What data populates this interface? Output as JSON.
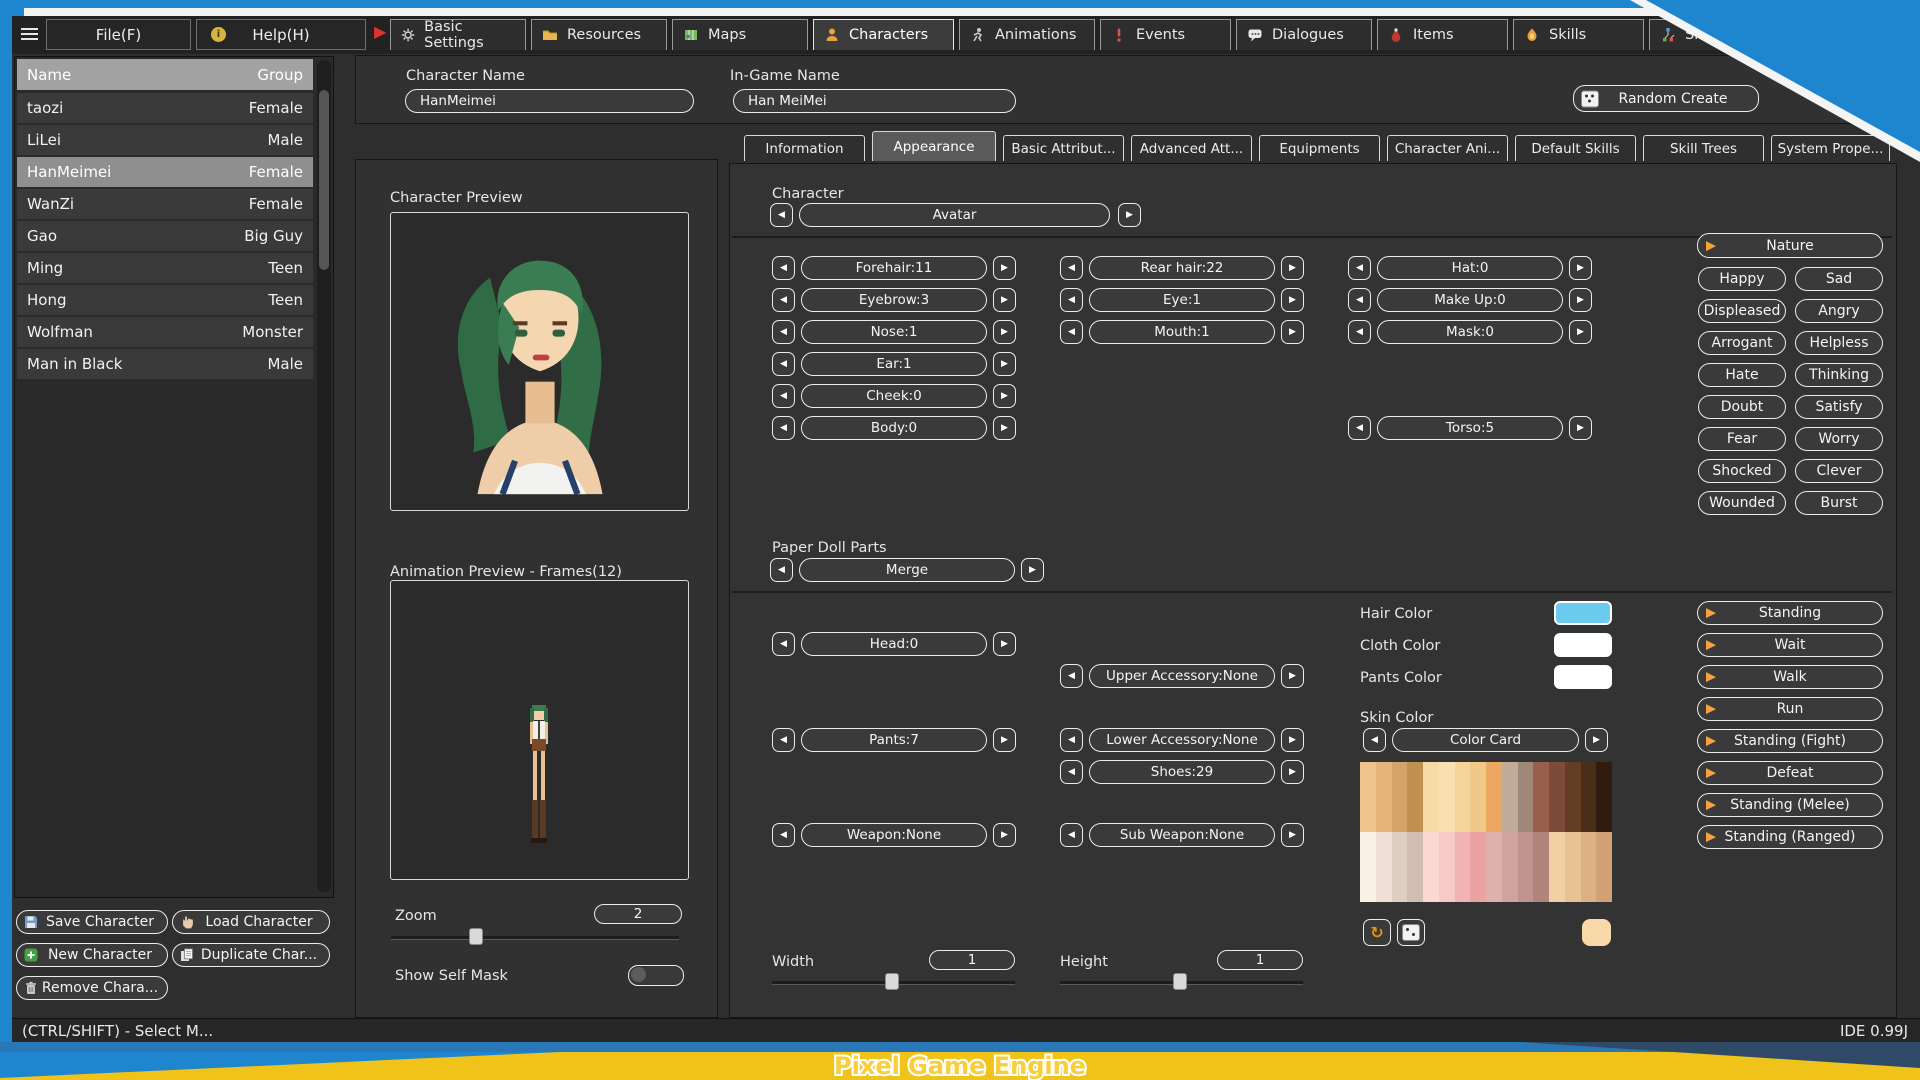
{
  "menu": {
    "file": "File(F)",
    "help": "Help(H)"
  },
  "main_tabs": [
    {
      "label": "Basic Settings"
    },
    {
      "label": "Resources"
    },
    {
      "label": "Maps"
    },
    {
      "label": "Characters",
      "active": true
    },
    {
      "label": "Animations"
    },
    {
      "label": "Events"
    },
    {
      "label": "Dialogues"
    },
    {
      "label": "Items"
    },
    {
      "label": "Skills"
    },
    {
      "label": "Skill Trees"
    }
  ],
  "character_list": {
    "header": {
      "name": "Name",
      "group": "Group"
    },
    "rows": [
      {
        "name": "taozi",
        "group": "Female"
      },
      {
        "name": "LiLei",
        "group": "Male"
      },
      {
        "name": "HanMeimei",
        "group": "Female",
        "selected": true
      },
      {
        "name": "WanZi",
        "group": "Female"
      },
      {
        "name": "Gao",
        "group": "Big Guy"
      },
      {
        "name": "Ming",
        "group": "Teen"
      },
      {
        "name": "Hong",
        "group": "Teen"
      },
      {
        "name": "Wolfman",
        "group": "Monster"
      },
      {
        "name": "Man in Black",
        "group": "Male"
      }
    ],
    "buttons": {
      "save": "Save Character",
      "load": "Load Character",
      "new": "New Character",
      "duplicate": "Duplicate Char...",
      "remove": "Remove Chara..."
    }
  },
  "name_bar": {
    "char_name_label": "Character Name",
    "char_name": "HanMeimei",
    "ingame_label": "In-Game Name",
    "ingame_name": "Han MeiMei",
    "random_create": "Random Create"
  },
  "editor_tabs": [
    {
      "label": "Information"
    },
    {
      "label": "Appearance",
      "active": true
    },
    {
      "label": "Basic Attribut..."
    },
    {
      "label": "Advanced Att..."
    },
    {
      "label": "Equipments"
    },
    {
      "label": "Character Ani..."
    },
    {
      "label": "Default Skills"
    },
    {
      "label": "Skill Trees"
    },
    {
      "label": "System Prope..."
    }
  ],
  "preview": {
    "title": "Character Preview",
    "anim_title": "Animation Preview - Frames(12)",
    "zoom_label": "Zoom",
    "zoom_value": "2",
    "mask_label": "Show Self Mask"
  },
  "character": {
    "section": "Character",
    "avatar": "Avatar",
    "col1": [
      "Forehair:11",
      "Eyebrow:3",
      "Nose:1",
      "Ear:1",
      "Cheek:0",
      "Body:0"
    ],
    "col2": [
      "Rear hair:22",
      "Eye:1",
      "Mouth:1"
    ],
    "col3": [
      "Hat:0",
      "Make Up:0",
      "Mask:0"
    ],
    "torso": "Torso:5"
  },
  "emotions": {
    "nature": "Nature",
    "items": [
      "Happy",
      "Sad",
      "Displeased",
      "Angry",
      "Arrogant",
      "Helpless",
      "Hate",
      "Thinking",
      "Doubt",
      "Satisfy",
      "Fear",
      "Worry",
      "Shocked",
      "Clever",
      "Wounded",
      "Burst"
    ]
  },
  "paperdoll": {
    "section": "Paper Doll Parts",
    "merge": "Merge",
    "head": "Head:0",
    "pants": "Pants:7",
    "weapon": "Weapon:None",
    "upper": "Upper Accessory:None",
    "lower": "Lower Accessory:None",
    "shoes": "Shoes:29",
    "subweapon": "Sub Weapon:None"
  },
  "colors": {
    "hair_label": "Hair Color",
    "hair": "#6BCBEF",
    "cloth_label": "Cloth Color",
    "cloth": "#FFFFFF",
    "pants_label": "Pants Color",
    "pants": "#FFFFFF",
    "skin_label": "Skin Color",
    "card": "Color Card",
    "selected": "#F8D8A8",
    "palette_top": [
      "#F0C28C",
      "#E4B478",
      "#D4A468",
      "#C09050",
      "#F6DCA4",
      "#F8E0B0",
      "#F4D498",
      "#F0C888",
      "#ECA860",
      "#C0AA98",
      "#A08878",
      "#985F4C",
      "#7C4C38",
      "#643E24",
      "#4A2E18",
      "#301C0E"
    ],
    "palette_bottom": [
      "#FAF0E6",
      "#EEE0D6",
      "#DECEC4",
      "#D0BEB2",
      "#FAD8D4",
      "#F6CAC6",
      "#F0B4B2",
      "#EAA2A2",
      "#DCB2AA",
      "#CEA49C",
      "#C0948C",
      "#B2847C",
      "#F0D0A4",
      "#E6C294",
      "#DCB284",
      "#D0A274"
    ]
  },
  "poses": [
    "Standing",
    "Wait",
    "Walk",
    "Run",
    "Standing (Fight)",
    "Defeat",
    "Standing (Melee)",
    "Standing (Ranged)"
  ],
  "size": {
    "width_label": "Width",
    "width_value": "1",
    "height_label": "Height",
    "height_value": "1"
  },
  "status": {
    "left": "(CTRL/SHIFT) - Select M...",
    "right": "IDE 0.99J"
  },
  "banner": {
    "title": "Pixel Game Engine"
  }
}
